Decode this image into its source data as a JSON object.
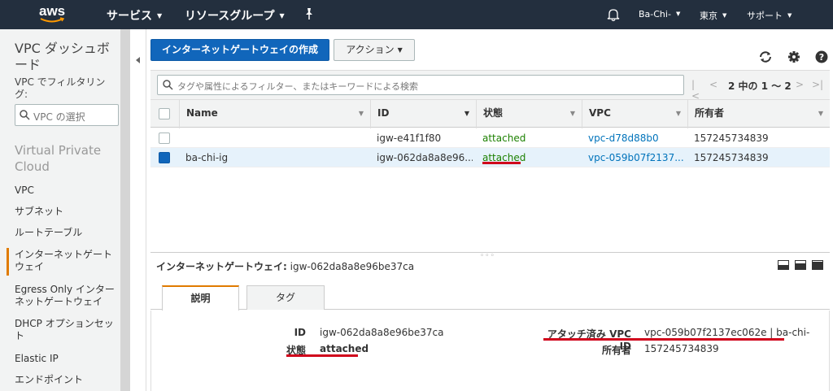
{
  "topnav": {
    "logo": "aws",
    "services": "サービス",
    "resource_groups": "リソースグループ",
    "user": "Ba-Chi-",
    "region": "東京",
    "support": "サポート"
  },
  "sidebar": {
    "title": "VPC ダッシュボード",
    "filter_label": "VPC でフィルタリング:",
    "vpc_select_placeholder": "VPC の選択",
    "section_title": "Virtual Private Cloud",
    "items": [
      {
        "label": "VPC"
      },
      {
        "label": "サブネット"
      },
      {
        "label": "ルートテーブル"
      },
      {
        "label": "インターネットゲートウェイ",
        "active": true
      },
      {
        "label": "Egress Only インターネットゲートウェイ"
      },
      {
        "label": "DHCP オプションセット"
      },
      {
        "label": "Elastic IP"
      },
      {
        "label": "エンドポイント"
      }
    ]
  },
  "toolbar": {
    "create_label": "インターネットゲートウェイの作成",
    "actions_label": "アクション"
  },
  "search": {
    "placeholder": "タグや属性によるフィルター、またはキーワードによる検索"
  },
  "pager": {
    "text": "2 中の 1 ～ 2"
  },
  "table": {
    "columns": [
      "Name",
      "ID",
      "状態",
      "VPC",
      "所有者"
    ],
    "rows": [
      {
        "name": "",
        "id": "igw-e41f1f80",
        "state": "attached",
        "vpc": "vpc-d78d88b0",
        "owner": "157245734839",
        "selected": false
      },
      {
        "name": "ba-chi-ig",
        "id": "igw-062da8a8e96...",
        "state": "attached",
        "vpc": "vpc-059b07f2137...",
        "owner": "157245734839",
        "selected": true
      }
    ]
  },
  "detail": {
    "title_label": "インターネットゲートウェイ:",
    "title_value": "igw-062da8a8e96be37ca",
    "tabs": [
      "説明",
      "タグ"
    ],
    "id_label": "ID",
    "id_value": "igw-062da8a8e96be37ca",
    "state_label": "状態",
    "state_value": "attached",
    "vpc_label": "アタッチ済み VPC ID",
    "vpc_value": "vpc-059b07f2137ec062e | ba-chi-",
    "owner_label": "所有者",
    "owner_value": "157245734839"
  },
  "colors": {
    "nav_bg": "#232f3e",
    "primary": "#1166bb",
    "attached_green": "#1d8102",
    "link_blue": "#0073bb",
    "highlight_red": "#d0021b",
    "active_orange": "#e07b00"
  }
}
